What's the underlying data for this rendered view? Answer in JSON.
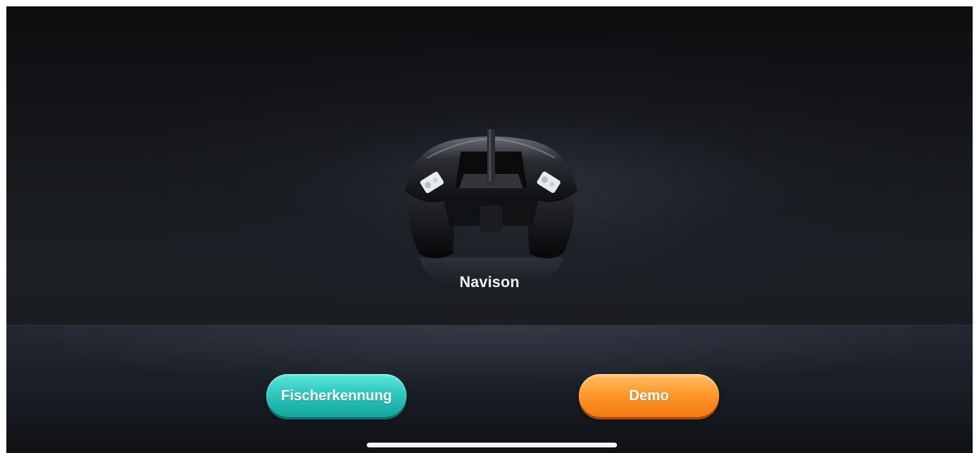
{
  "product": {
    "name": "Navison",
    "image_icon": "bait-boat-icon"
  },
  "buttons": {
    "primary_label": "Fischerkennung",
    "secondary_label": "Demo"
  },
  "colors": {
    "primary_button": "#2fc8bf",
    "secondary_button": "#ff9a2e",
    "background": "#141518"
  }
}
